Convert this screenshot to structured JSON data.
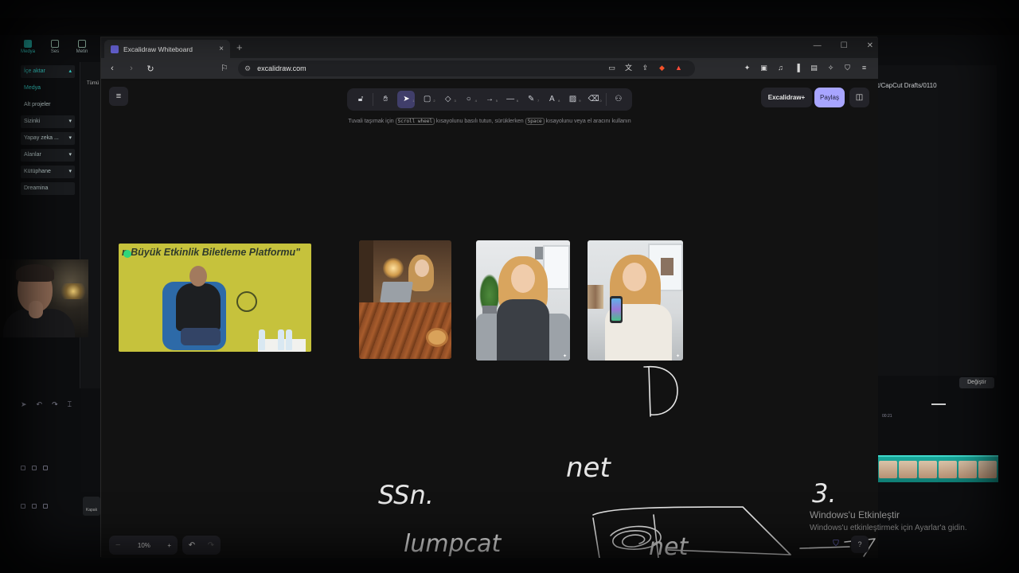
{
  "capcut": {
    "tools": [
      {
        "label": "Medya",
        "icon": "media-icon"
      },
      {
        "label": "Ses",
        "icon": "audio-icon"
      },
      {
        "label": "Metin",
        "icon": "text-icon"
      }
    ],
    "sidebar": [
      {
        "label": "İçe aktar",
        "chevron": "▴"
      },
      {
        "label": "Medya",
        "chevron": ""
      },
      {
        "label": "Alt projeler",
        "chevron": ""
      },
      {
        "label": "Sizinki",
        "chevron": "▾"
      },
      {
        "label": "Yapay zeka ...",
        "chevron": "▾"
      },
      {
        "label": "Alanlar",
        "chevron": "▾"
      },
      {
        "label": "Kütüphane",
        "chevron": "▾"
      },
      {
        "label": "Dreamina",
        "chevron": ""
      }
    ],
    "panel_text": "Tümü",
    "right_path": "t/CapCut Drafts/0110",
    "change_button": "Değiştir",
    "kapak_label": "Kapak",
    "time_marker": "00:21"
  },
  "browser": {
    "tab_title": "Excalidraw Whiteboard",
    "url": "excalidraw.com"
  },
  "excalidraw": {
    "library_button": "Excalidraw+",
    "share_button": "Paylaş",
    "hint": {
      "part1": "Tuvali taşımak için",
      "key1": "Scroll wheel",
      "part2": "kısayolunu basılı tutun, sürüklerken",
      "key2": "Space",
      "part3": "kısayolunu veya el aracını kullanın"
    },
    "zoom_level": "10%",
    "event_banner": "n Büyük Etkinlik Biletleme Platformu\"",
    "handwriting": [
      "net",
      "3.",
      "SSn.",
      "lumpcat",
      "net"
    ]
  },
  "windows_activation": {
    "title": "Windows'u Etkinleştir",
    "subtitle": "Windows'u etkinleştirmek için Ayarlar'a gidin."
  }
}
